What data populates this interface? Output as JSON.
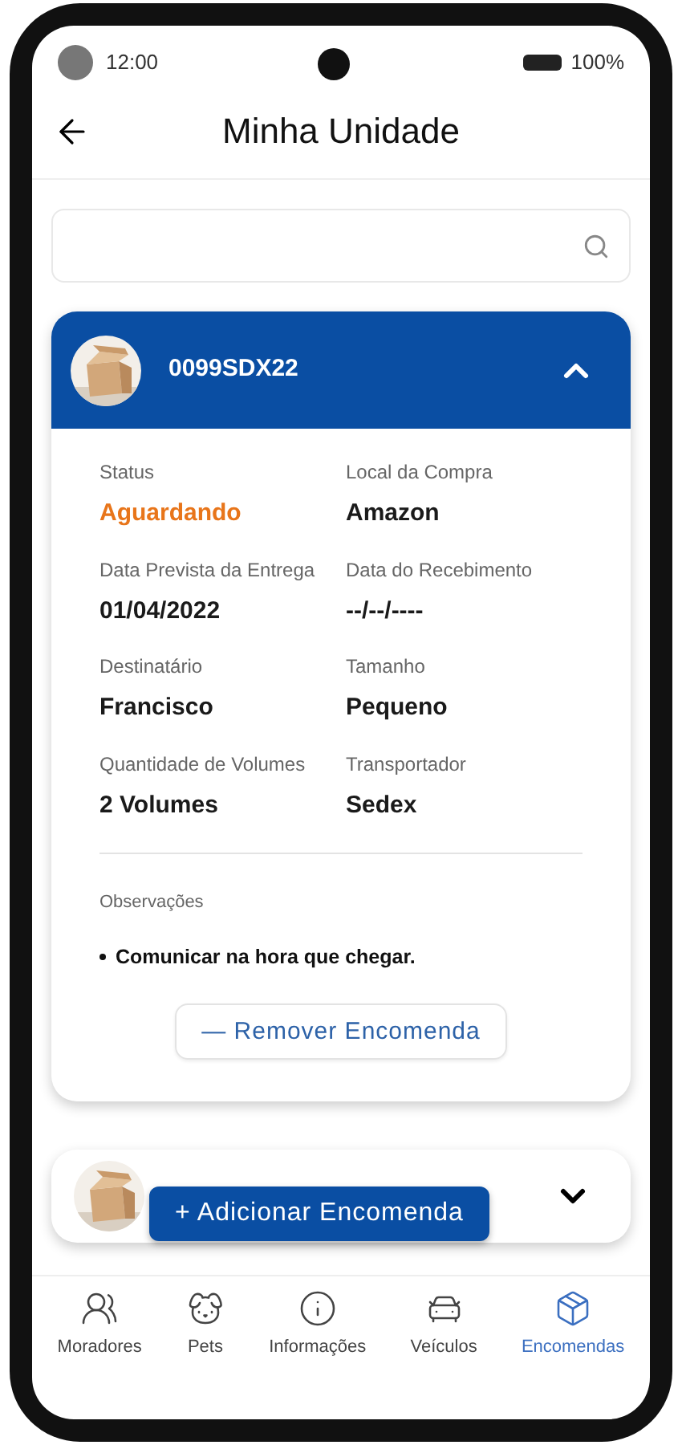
{
  "status_bar": {
    "time": "12:00",
    "battery": "100%"
  },
  "header": {
    "title": "Minha Unidade"
  },
  "orders": [
    {
      "code": "0099SDX22",
      "expanded": true,
      "fields": [
        {
          "label": "Status",
          "value": "Aguardando",
          "color": "#e8751a"
        },
        {
          "label": "Local da Compra",
          "value": "Amazon",
          "color": "#1a1a1a"
        },
        {
          "label": "Data Prevista da Entrega",
          "value": "01/04/2022",
          "color": "#1a1a1a"
        },
        {
          "label": "Data do Recebimento",
          "value": "--/--/----",
          "color": "#1a1a1a"
        },
        {
          "label": "Destinatário",
          "value": "Francisco",
          "color": "#1a1a1a"
        },
        {
          "label": "Tamanho",
          "value": "Pequeno",
          "color": "#1a1a1a"
        },
        {
          "label": "Quantidade de Volumes",
          "value": "2 Volumes",
          "color": "#1a1a1a"
        },
        {
          "label": "Transportador",
          "value": "Sedex",
          "color": "#1a1a1a"
        }
      ],
      "notes_label": "Observações",
      "notes": [
        "Comunicar na hora que chegar."
      ],
      "remove_button": "— Remover Encomenda"
    },
    {
      "expanded": false
    }
  ],
  "add_button": "+ Adicionar Encomenda",
  "nav": [
    {
      "label": "Moradores",
      "kind": "users",
      "selected": false
    },
    {
      "label": "Pets",
      "kind": "dog",
      "selected": false
    },
    {
      "label": "Informações",
      "kind": "info",
      "selected": false
    },
    {
      "label": "Veículos",
      "kind": "car",
      "selected": false
    },
    {
      "label": "Encomendas",
      "kind": "package",
      "selected": true
    }
  ]
}
